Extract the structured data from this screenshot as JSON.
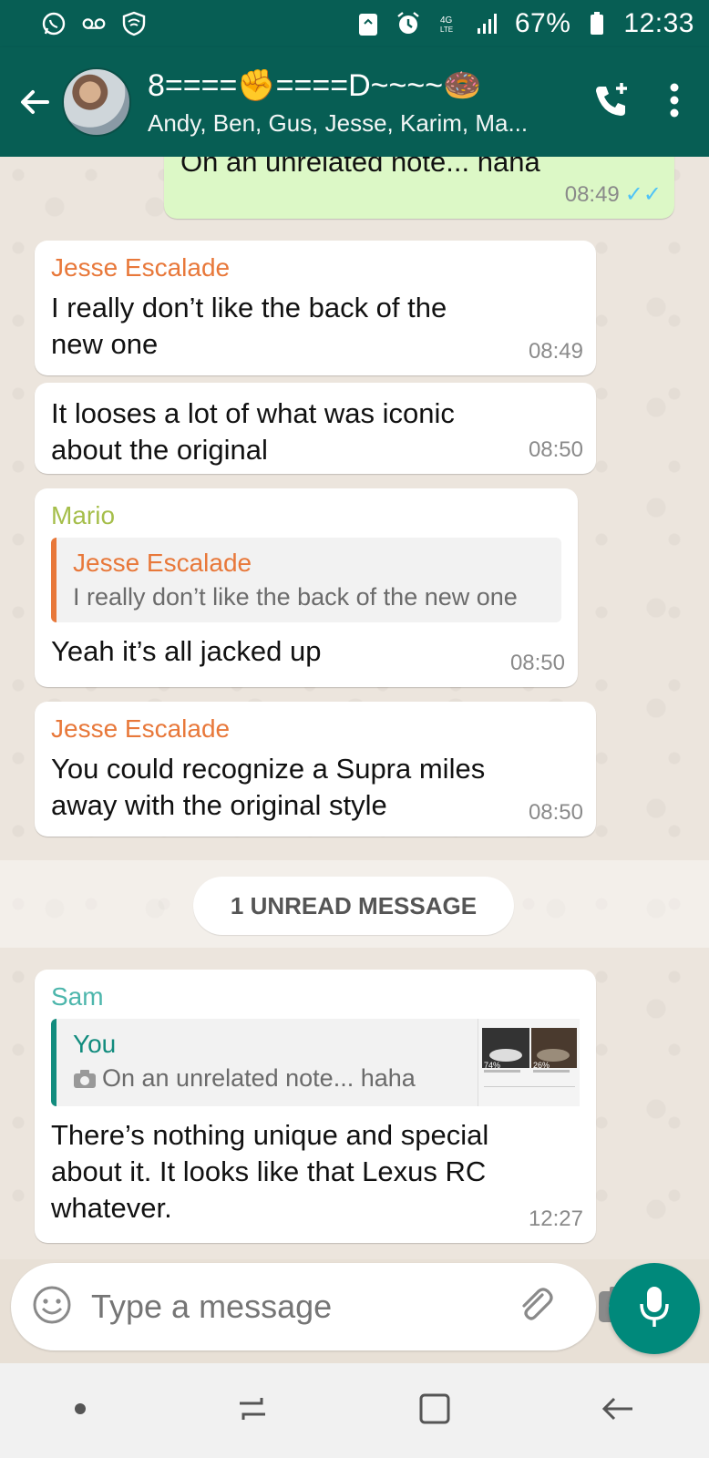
{
  "status_bar": {
    "battery": "67%",
    "time": "12:33",
    "icons": [
      "whatsapp-icon",
      "voicemail-icon",
      "shield-icon",
      "recycle-icon",
      "alarm-icon",
      "lte-icon",
      "signal-icon",
      "battery-icon"
    ]
  },
  "header": {
    "title": "8====✊====D~~~~🍩",
    "subtitle": "Andy, Ben, Gus, Jesse, Karim, Ma...",
    "back_icon": "back-arrow-icon",
    "call_icon": "add-call-icon",
    "menu_icon": "more-vert-icon"
  },
  "messages": [
    {
      "id": "m0",
      "direction": "out",
      "text": "On an unrelated note... haha",
      "time": "08:49",
      "ticks": "✓✓"
    },
    {
      "id": "m1",
      "sender": "Jesse Escalade",
      "sender_color": "#e8783a",
      "text": "I really don’t like the back of the new one",
      "time": "08:49"
    },
    {
      "id": "m2",
      "text": "It looses a lot of what was iconic about the original",
      "time": "08:50"
    },
    {
      "id": "m3",
      "sender": "Mario",
      "sender_color": "#a5be4a",
      "quote": {
        "name": "Jesse Escalade",
        "text": "I really don’t like the back of the new one"
      },
      "text": "Yeah it’s all jacked up",
      "time": "08:50"
    },
    {
      "id": "m4",
      "sender": "Jesse Escalade",
      "sender_color": "#e8783a",
      "text": "You could recognize a Supra miles away with the original style",
      "time": "08:50"
    },
    {
      "id": "m5",
      "sender": "Sam",
      "sender_color": "#4db6ac",
      "quote": {
        "name": "You",
        "text": "On an unrelated note... haha",
        "thumb_labels": [
          "74%",
          "26%"
        ]
      },
      "text": "There’s nothing unique and special about it. It looks like that Lexus RC whatever.",
      "time": "12:27"
    }
  ],
  "unread_label": "1 UNREAD MESSAGE",
  "composer": {
    "placeholder": "Type a message",
    "emoji_icon": "emoji-icon",
    "attach_icon": "paperclip-icon",
    "camera_icon": "camera-icon",
    "mic_icon": "mic-icon"
  },
  "colors": {
    "header": "#075e54",
    "outgoing_bubble": "#dcf8c6",
    "mic": "#00897b"
  }
}
